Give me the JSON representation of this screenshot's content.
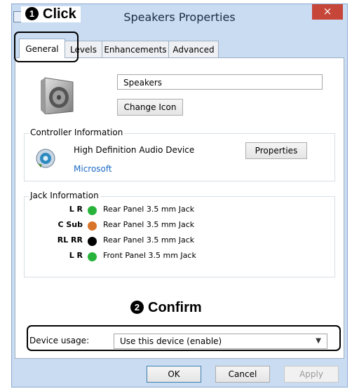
{
  "window": {
    "title": "Speakers Properties",
    "close_glyph": "×"
  },
  "tabs": [
    {
      "label": "General"
    },
    {
      "label": "Levels"
    },
    {
      "label": "Enhancements"
    },
    {
      "label": "Advanced"
    }
  ],
  "general": {
    "device_name": "Speakers",
    "change_icon_label": "Change Icon"
  },
  "controller": {
    "title": "Controller Information",
    "device": "High Definition Audio Device",
    "vendor": "Microsoft",
    "properties_label": "Properties"
  },
  "jack": {
    "title": "Jack Information",
    "rows": [
      {
        "channels": "L R",
        "color": "#27b33a",
        "label": "Rear Panel 3.5 mm Jack"
      },
      {
        "channels": "C Sub",
        "color": "#d8742a",
        "label": "Rear Panel 3.5 mm Jack"
      },
      {
        "channels": "RL RR",
        "color": "#000000",
        "label": "Rear Panel 3.5 mm Jack"
      },
      {
        "channels": "L R",
        "color": "#27b33a",
        "label": "Front Panel 3.5 mm Jack"
      }
    ]
  },
  "device_usage": {
    "label": "Device usage:",
    "value": "Use this device (enable)"
  },
  "buttons": {
    "ok": "OK",
    "cancel": "Cancel",
    "apply": "Apply"
  },
  "annotations": {
    "step1_num": "1",
    "step1_text": "Click",
    "step2_num": "2",
    "step2_text": "Confirm"
  }
}
